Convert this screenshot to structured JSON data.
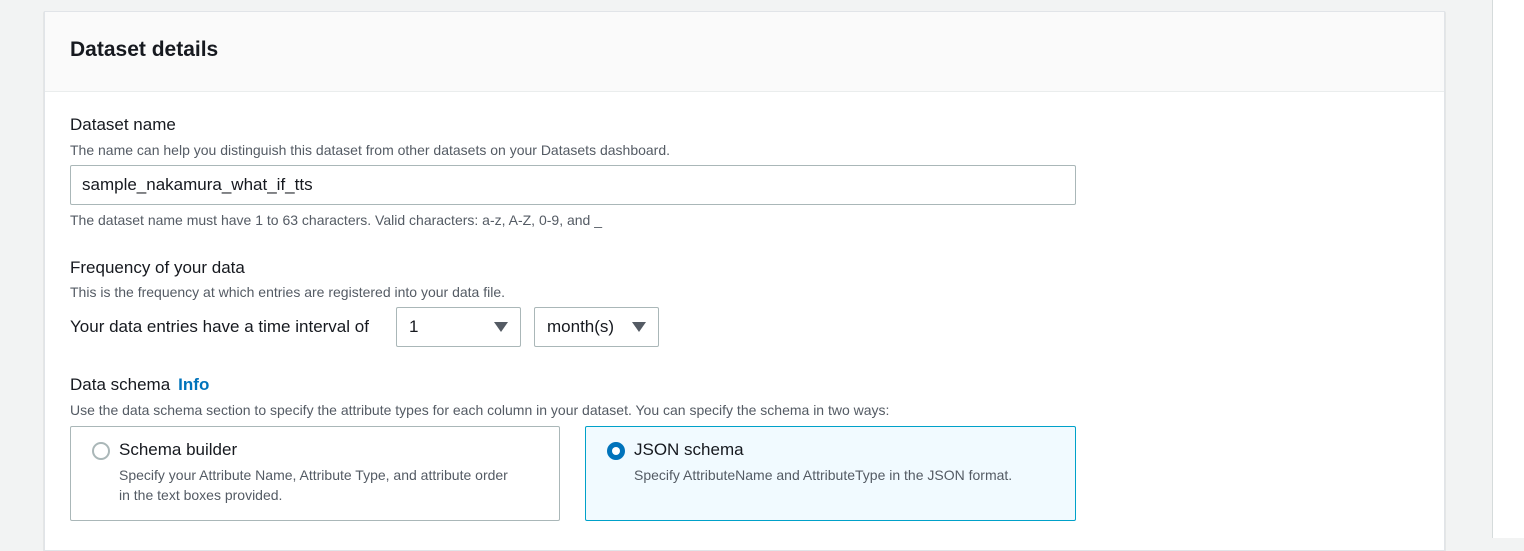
{
  "panel": {
    "title": "Dataset details"
  },
  "dataset_name": {
    "label": "Dataset name",
    "description": "The name can help you distinguish this dataset from other datasets on your Datasets dashboard.",
    "value": "sample_nakamura_what_if_tts",
    "constraint": "The dataset name must have 1 to 63 characters. Valid characters: a-z, A-Z, 0-9, and _"
  },
  "frequency": {
    "label": "Frequency of your data",
    "description": "This is the frequency at which entries are registered into your data file.",
    "interval_label": "Your data entries have a time interval of",
    "interval_value": "1",
    "unit_value": "month(s)"
  },
  "data_schema": {
    "label": "Data schema",
    "info_link": "Info",
    "description": "Use the data schema section to specify the attribute types for each column in your dataset. You can specify the schema in two ways:",
    "options": [
      {
        "title": "Schema builder",
        "description_line1": "Specify your Attribute Name, Attribute Type, and attribute order",
        "description_line2": "in the text boxes provided.",
        "selected": false
      },
      {
        "title": "JSON schema",
        "description": "Specify AttributeName and AttributeType in the JSON format.",
        "selected": true
      }
    ]
  },
  "colors": {
    "accent": "#0073bb",
    "selected_border": "#00a1c9",
    "selected_bg": "#f1faff",
    "page_bg": "#f2f3f3"
  }
}
